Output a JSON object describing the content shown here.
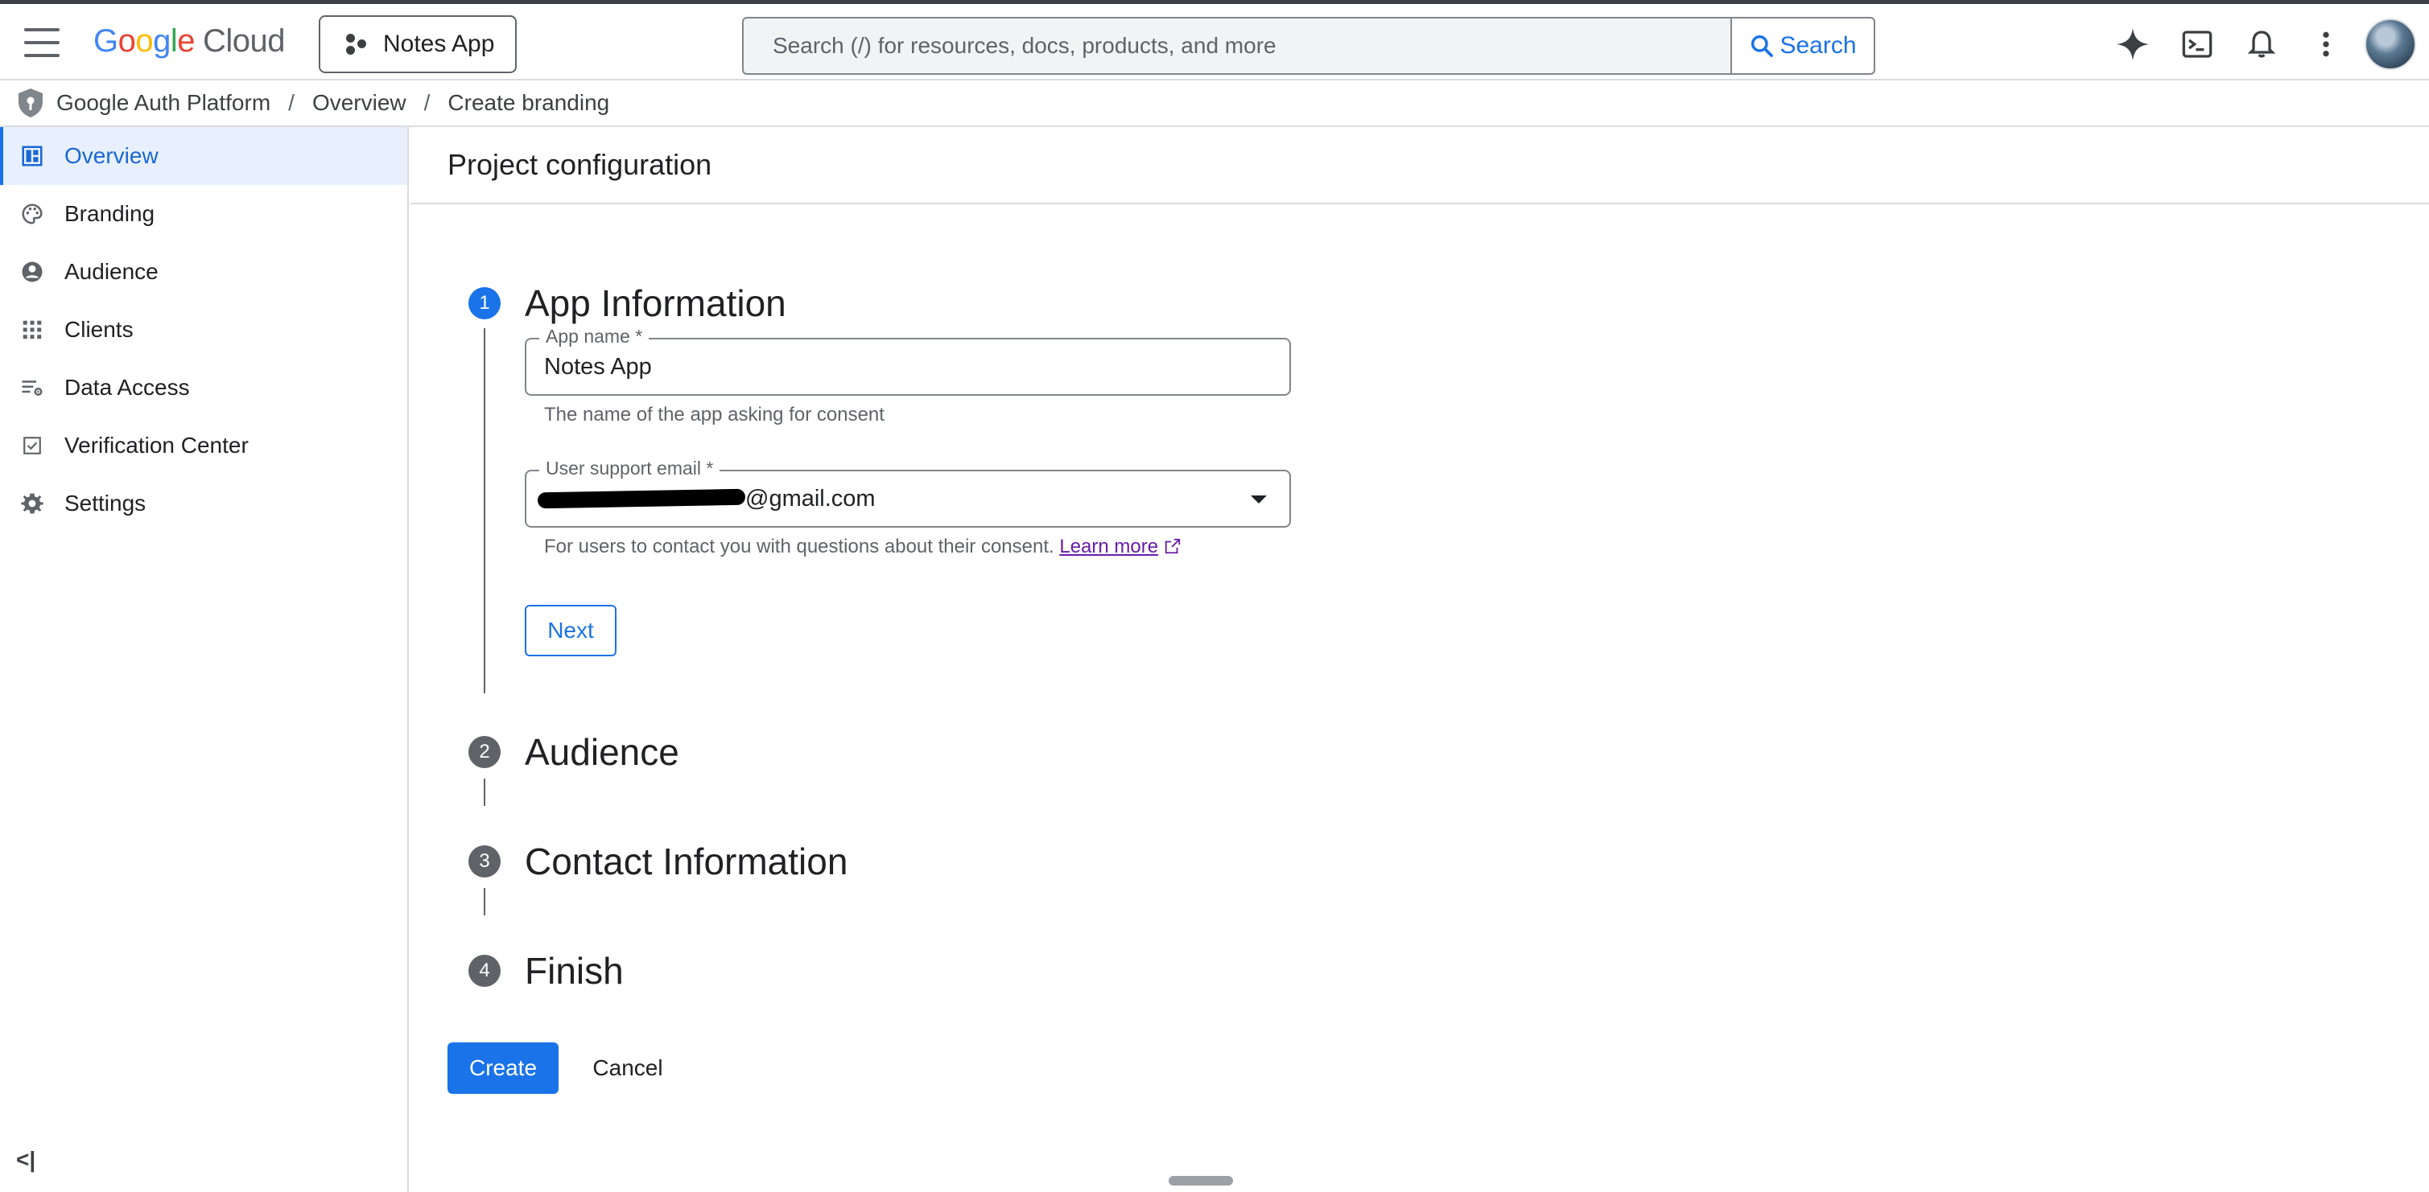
{
  "topbar": {
    "logo_google": "Google",
    "logo_cloud": "Cloud",
    "project_name": "Notes App",
    "search_placeholder": "Search (/) for resources, docs, products, and more",
    "search_button": "Search"
  },
  "breadcrumb": {
    "items": [
      "Google Auth Platform",
      "Overview",
      "Create branding"
    ],
    "separator": "/"
  },
  "sidebar": {
    "items": [
      {
        "label": "Overview",
        "icon": "dashboard-icon",
        "active": true
      },
      {
        "label": "Branding",
        "icon": "palette-icon"
      },
      {
        "label": "Audience",
        "icon": "account-circle-icon"
      },
      {
        "label": "Clients",
        "icon": "apps-grid-icon"
      },
      {
        "label": "Data Access",
        "icon": "data-access-icon"
      },
      {
        "label": "Verification Center",
        "icon": "verified-checkbox-icon"
      },
      {
        "label": "Settings",
        "icon": "gear-icon"
      }
    ],
    "collapse_label": "<|"
  },
  "main": {
    "header": "Project configuration",
    "steps": [
      {
        "num": "1",
        "title": "App Information",
        "active": true
      },
      {
        "num": "2",
        "title": "Audience"
      },
      {
        "num": "3",
        "title": "Contact Information"
      },
      {
        "num": "4",
        "title": "Finish"
      }
    ],
    "app_name": {
      "label": "App name *",
      "value": "Notes App",
      "hint": "The name of the app asking for consent"
    },
    "support_email": {
      "label": "User support email *",
      "value_suffix": "@gmail.com",
      "hint": "For users to contact you with questions about their consent.",
      "learn_more": "Learn more"
    },
    "next_button": "Next",
    "create_button": "Create",
    "cancel_button": "Cancel"
  },
  "colors": {
    "accent": "#1a73e8",
    "active_nav_bg": "#e8f0fe",
    "link_visited": "#681da8"
  }
}
